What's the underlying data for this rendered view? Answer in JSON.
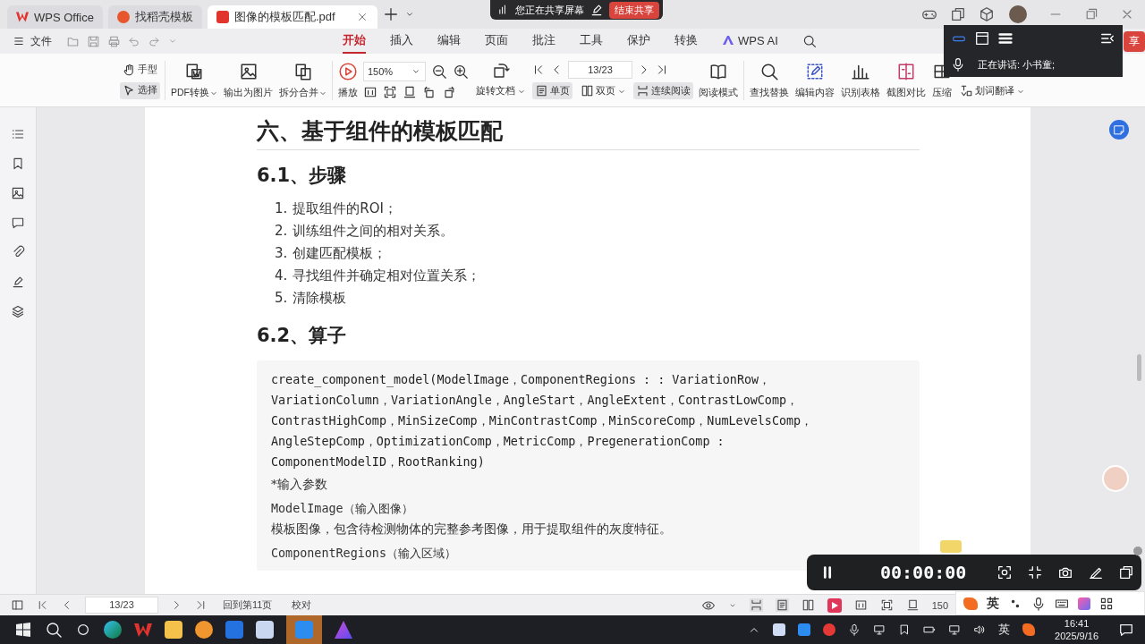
{
  "tabs": [
    {
      "label": "WPS Office",
      "selected": false,
      "kind": "home"
    },
    {
      "label": "找稻壳模板",
      "selected": false,
      "kind": "template"
    },
    {
      "label": "图像的模板匹配.pdf",
      "selected": true,
      "kind": "pdf"
    }
  ],
  "share_bar": {
    "status": "您正在共享屏幕",
    "end_button": "结束共享"
  },
  "menu": {
    "file": "文件",
    "tabs": [
      {
        "label": "开始",
        "selected": true,
        "kind": "text"
      },
      {
        "label": "插入",
        "selected": false,
        "kind": "text"
      },
      {
        "label": "编辑",
        "selected": false,
        "kind": "text"
      },
      {
        "label": "页面",
        "selected": false,
        "kind": "text"
      },
      {
        "label": "批注",
        "selected": false,
        "kind": "text"
      },
      {
        "label": "工具",
        "selected": false,
        "kind": "text"
      },
      {
        "label": "保护",
        "selected": false,
        "kind": "text"
      },
      {
        "label": "转换",
        "selected": false,
        "kind": "text"
      },
      {
        "label": "WPS AI",
        "selected": false,
        "kind": "ai"
      }
    ],
    "share_button": "享"
  },
  "ribbon": {
    "modes": [
      {
        "label": "手型",
        "selected": false
      },
      {
        "label": "选择",
        "selected": true
      }
    ],
    "convert": [
      {
        "label": "PDF转换",
        "dropdown": true
      },
      {
        "label": "输出为图片",
        "dropdown": false
      },
      {
        "label": "拆分合并",
        "dropdown": true
      }
    ],
    "play": "播放",
    "zoom": "150%",
    "rotate": "旋转文档",
    "page": "13/23",
    "views": [
      {
        "label": "单页",
        "selected": true,
        "dropdown": false
      },
      {
        "label": "双页",
        "selected": false,
        "dropdown": true
      },
      {
        "label": "连续阅读",
        "selected": true,
        "dropdown": false
      }
    ],
    "read_mode": "阅读模式",
    "tools": [
      {
        "label": "查找替换"
      },
      {
        "label": "编辑内容"
      },
      {
        "label": "识别表格"
      },
      {
        "label": "截图对比"
      },
      {
        "label": "压缩"
      }
    ],
    "translate": "划词翻译"
  },
  "speaking": {
    "text": "正在讲话:  小书童;"
  },
  "document": {
    "title": "六、基于组件的模板匹配",
    "section1": "6.1、步骤",
    "steps": [
      {
        "number": "1.",
        "text": "提取组件的ROI；"
      },
      {
        "number": "2.",
        "text": "训练组件之间的相对关系。"
      },
      {
        "number": "3.",
        "text": "创建匹配模板；"
      },
      {
        "number": "4.",
        "text": "寻找组件并确定相对位置关系；"
      },
      {
        "number": "5.",
        "text": "清除模板"
      }
    ],
    "section2": "6.2、算子",
    "code": "create_component_model(ModelImage，ComponentRegions : : VariationRow，\nVariationColumn，VariationAngle，AngleStart，AngleExtent，ContrastLowComp，\nContrastHighComp，MinSizeComp，MinContrastComp，MinScoreComp，NumLevelsComp，\nAngleStepComp，OptimizationComp，MetricComp，PregenerationComp :\nComponentModelID，RootRanking)",
    "params_label": "*输入参数",
    "params": [
      {
        "name": "ModelImage（输入图像）",
        "description": "模板图像，包含待检测物体的完整参考图像，用于提取组件的灰度特征。"
      },
      {
        "name": "ComponentRegions（输入区域）"
      }
    ]
  },
  "status_bar": {
    "page": "13/23",
    "back_link": "回到第11页",
    "proofread": "校对",
    "zoom": "150"
  },
  "recorder": {
    "time": "00:00:00"
  },
  "ime": {
    "language": "英"
  },
  "taskbar": {
    "language": "英",
    "time": "16:41",
    "date": "2025/9/16"
  }
}
